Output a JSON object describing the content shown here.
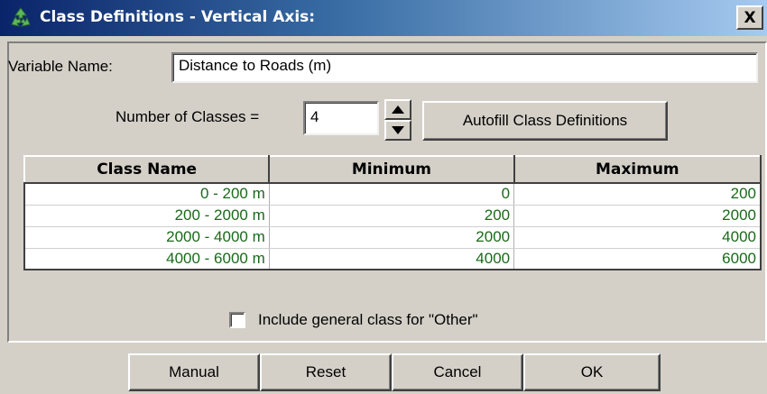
{
  "window": {
    "title": "Class Definitions - Vertical Axis:",
    "close_label": "X"
  },
  "variable": {
    "label": "Variable Name:",
    "value": "Distance to Roads (m)"
  },
  "classes": {
    "label": "Number of Classes =",
    "value": "4",
    "autofill_label": "Autofill Class Definitions"
  },
  "table": {
    "headers": [
      "Class Name",
      "Minimum",
      "Maximum"
    ],
    "rows": [
      [
        "0 - 200 m",
        "0",
        "200"
      ],
      [
        "200 - 2000 m",
        "200",
        "2000"
      ],
      [
        "2000 - 4000 m",
        "2000",
        "4000"
      ],
      [
        "4000 - 6000 m",
        "4000",
        "6000"
      ]
    ],
    "value_color": "#1a6a1a"
  },
  "other_class": {
    "label": "Include general class for \"Other\"",
    "checked": false
  },
  "buttons": {
    "manual": "Manual",
    "reset": "Reset",
    "cancel": "Cancel",
    "ok": "OK"
  },
  "icons": {
    "app": "recycle-icon",
    "close": "close-icon",
    "spin_up": "arrow-up-icon",
    "spin_down": "arrow-down-icon"
  }
}
